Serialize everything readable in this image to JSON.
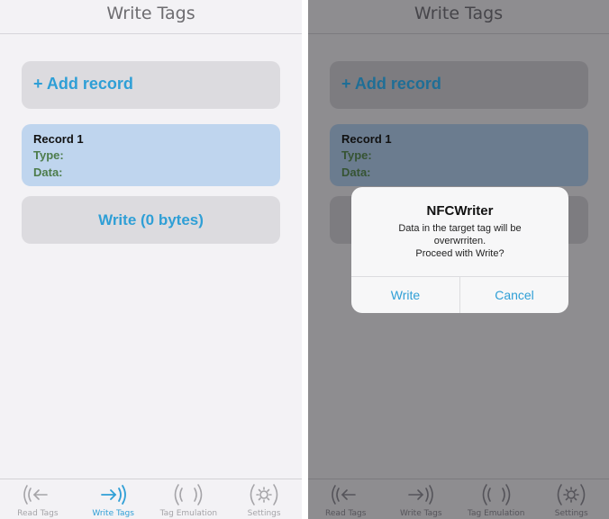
{
  "nav": {
    "title": "Write Tags"
  },
  "main": {
    "add_record_label": "+ Add record",
    "record": {
      "title": "Record 1",
      "type_label": "Type:",
      "data_label": "Data:"
    },
    "write_label": "Write (0 bytes)"
  },
  "tabs": [
    {
      "label": "Read Tags",
      "icon": "read-tags-icon"
    },
    {
      "label": "Write Tags",
      "icon": "write-tags-icon",
      "active": true
    },
    {
      "label": "Tag Emulation",
      "icon": "tag-emulation-icon"
    },
    {
      "label": "Settings",
      "icon": "settings-icon"
    }
  ],
  "dialog": {
    "title": "NFCWriter",
    "message_line1": "Data in the target tag will be",
    "message_line2": "overwrriten.",
    "message_line3": "Proceed with Write?",
    "confirm_label": "Write",
    "cancel_label": "Cancel"
  },
  "colors": {
    "accent": "#2f9fd6",
    "record_bg": "#bfd5ee",
    "record_text": "#4d7c4b",
    "dim_overlay": "#8e8d90"
  }
}
